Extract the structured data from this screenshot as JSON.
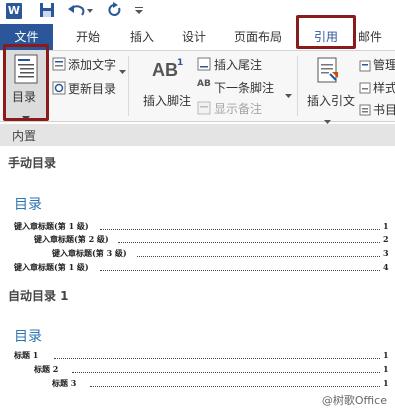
{
  "quick_access": {
    "app_icon_letter": "W"
  },
  "tabs": {
    "file": "文件",
    "home": "开始",
    "insert": "插入",
    "design": "设计",
    "layout": "页面布局",
    "references": "引用",
    "mailings": "邮件"
  },
  "ribbon": {
    "toc_label": "目录",
    "add_text": "添加文字",
    "update_toc": "更新目录",
    "insert_footnote": "插入脚注",
    "insert_endnote": "插入尾注",
    "next_footnote": "下一条脚注",
    "show_notes": "显示备注",
    "insert_citation": "插入引文",
    "manage_sources": "管理",
    "style": "样式",
    "bibliography": "书目",
    "footnote_icon": "AB"
  },
  "panel": {
    "section_builtin": "内置",
    "manual_title": "手动目录",
    "manual_toc_heading": "目录",
    "manual_entries": [
      {
        "text": "键入章标题(第 1 级)",
        "page": "1"
      },
      {
        "text": "键入章标题(第 2 级)",
        "page": "2"
      },
      {
        "text": "键入章标题(第 3 级)",
        "page": "3"
      },
      {
        "text": "键入章标题(第 1 级)",
        "page": "4"
      }
    ],
    "auto_title": "自动目录 1",
    "auto_toc_heading": "目录",
    "auto_entries": [
      {
        "text": "标题 1",
        "page": "1"
      },
      {
        "text": "标题 2",
        "page": "1"
      },
      {
        "text": "标题 3",
        "page": "1"
      }
    ]
  },
  "watermark": "@树歌Office",
  "colors": {
    "accent": "#2b579a",
    "highlight_box": "#8b1a1a",
    "toc_heading": "#2e74b5"
  }
}
